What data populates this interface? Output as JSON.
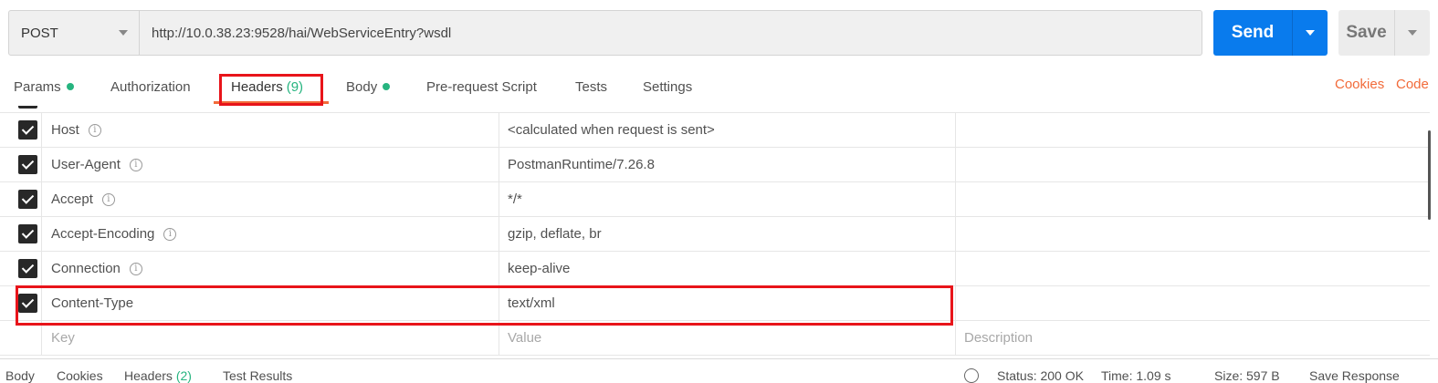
{
  "request": {
    "method": "POST",
    "url": "http://10.0.38.23:9528/hai/WebServiceEntry?wsdl",
    "send_label": "Send",
    "save_label": "Save"
  },
  "tabs": [
    {
      "label": "Params",
      "dot": true
    },
    {
      "label": "Authorization",
      "dot": false
    },
    {
      "label": "Headers",
      "count": "(9)",
      "active": true
    },
    {
      "label": "Body",
      "dot": true
    },
    {
      "label": "Pre-request Script",
      "dot": false
    },
    {
      "label": "Tests",
      "dot": false
    },
    {
      "label": "Settings",
      "dot": false
    }
  ],
  "right_links": {
    "cookies": "Cookies",
    "code": "Code"
  },
  "headers": [
    {
      "key": "Host",
      "value": "<calculated when request is sent>",
      "info": true,
      "checked": true
    },
    {
      "key": "User-Agent",
      "value": "PostmanRuntime/7.26.8",
      "info": true,
      "checked": true
    },
    {
      "key": "Accept",
      "value": "*/*",
      "info": true,
      "checked": true
    },
    {
      "key": "Accept-Encoding",
      "value": "gzip, deflate, br",
      "info": true,
      "checked": true
    },
    {
      "key": "Connection",
      "value": "keep-alive",
      "info": true,
      "checked": true
    },
    {
      "key": "Content-Type",
      "value": "text/xml",
      "info": false,
      "checked": true
    }
  ],
  "new_row": {
    "key_placeholder": "Key",
    "value_placeholder": "Value",
    "description_placeholder": "Description"
  },
  "info_glyph": "i",
  "bottom": {
    "body": "Body",
    "cookies": "Cookies",
    "headers": "Headers",
    "headers_count": "(2)",
    "test_results": "Test Results",
    "status": "Status: 200 OK",
    "time": "Time: 1.09 s",
    "size": "Size: 597 B",
    "save_response": "Save Response"
  },
  "colors": {
    "accent": "#f26b3a",
    "primary": "#097bed",
    "success": "#26b47f",
    "annotation": "#e8141a"
  }
}
